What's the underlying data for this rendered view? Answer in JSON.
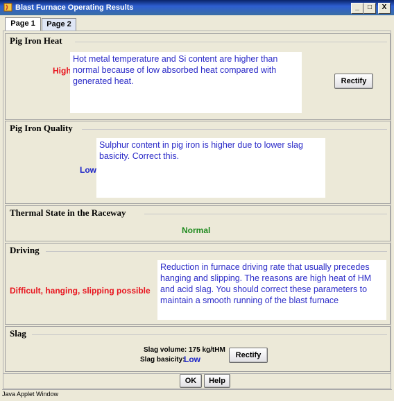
{
  "window": {
    "title": "Blast Furnace Operating Results",
    "controls": [
      "_",
      "□",
      "X"
    ]
  },
  "tabs": [
    {
      "label": "Page 1",
      "active": true
    },
    {
      "label": "Page 2",
      "active": false
    }
  ],
  "sections": {
    "pig_iron_heat": {
      "title": "Pig Iron Heat",
      "status": "High",
      "message": "Hot metal temperature and Si content are higher than normal because of low absorbed heat compared with generated heat.",
      "button": "Rectify"
    },
    "pig_iron_quality": {
      "title": "Pig Iron Quality",
      "status": "Low",
      "message": "Sulphur content in pig iron is higher due to lower slag basicity. Correct this."
    },
    "thermal_state": {
      "title": "Thermal State in the Raceway",
      "status": "Normal"
    },
    "driving": {
      "title": "Driving",
      "status": "Difficult, hanging, slipping possible",
      "message": "Reduction in furnace driving rate that usually precedes hanging and slipping. The reasons are high heat of HM and acid slag. You should correct these parameters to maintain a smooth running of the blast furnace"
    },
    "slag": {
      "title": "Slag",
      "volume_label": "Slag volume:",
      "volume_value": "175 kg/tHM",
      "basicity_label": "Slag basicity:",
      "basicity_value": "Low",
      "button": "Rectify"
    }
  },
  "footer": {
    "ok": "OK",
    "help": "Help"
  },
  "statusbar": "Java Applet Window",
  "colors": {
    "status_red": "#e8141e",
    "status_blue": "#1a22c8",
    "status_green": "#1e8a1e",
    "message_text": "#2b2bc8"
  }
}
